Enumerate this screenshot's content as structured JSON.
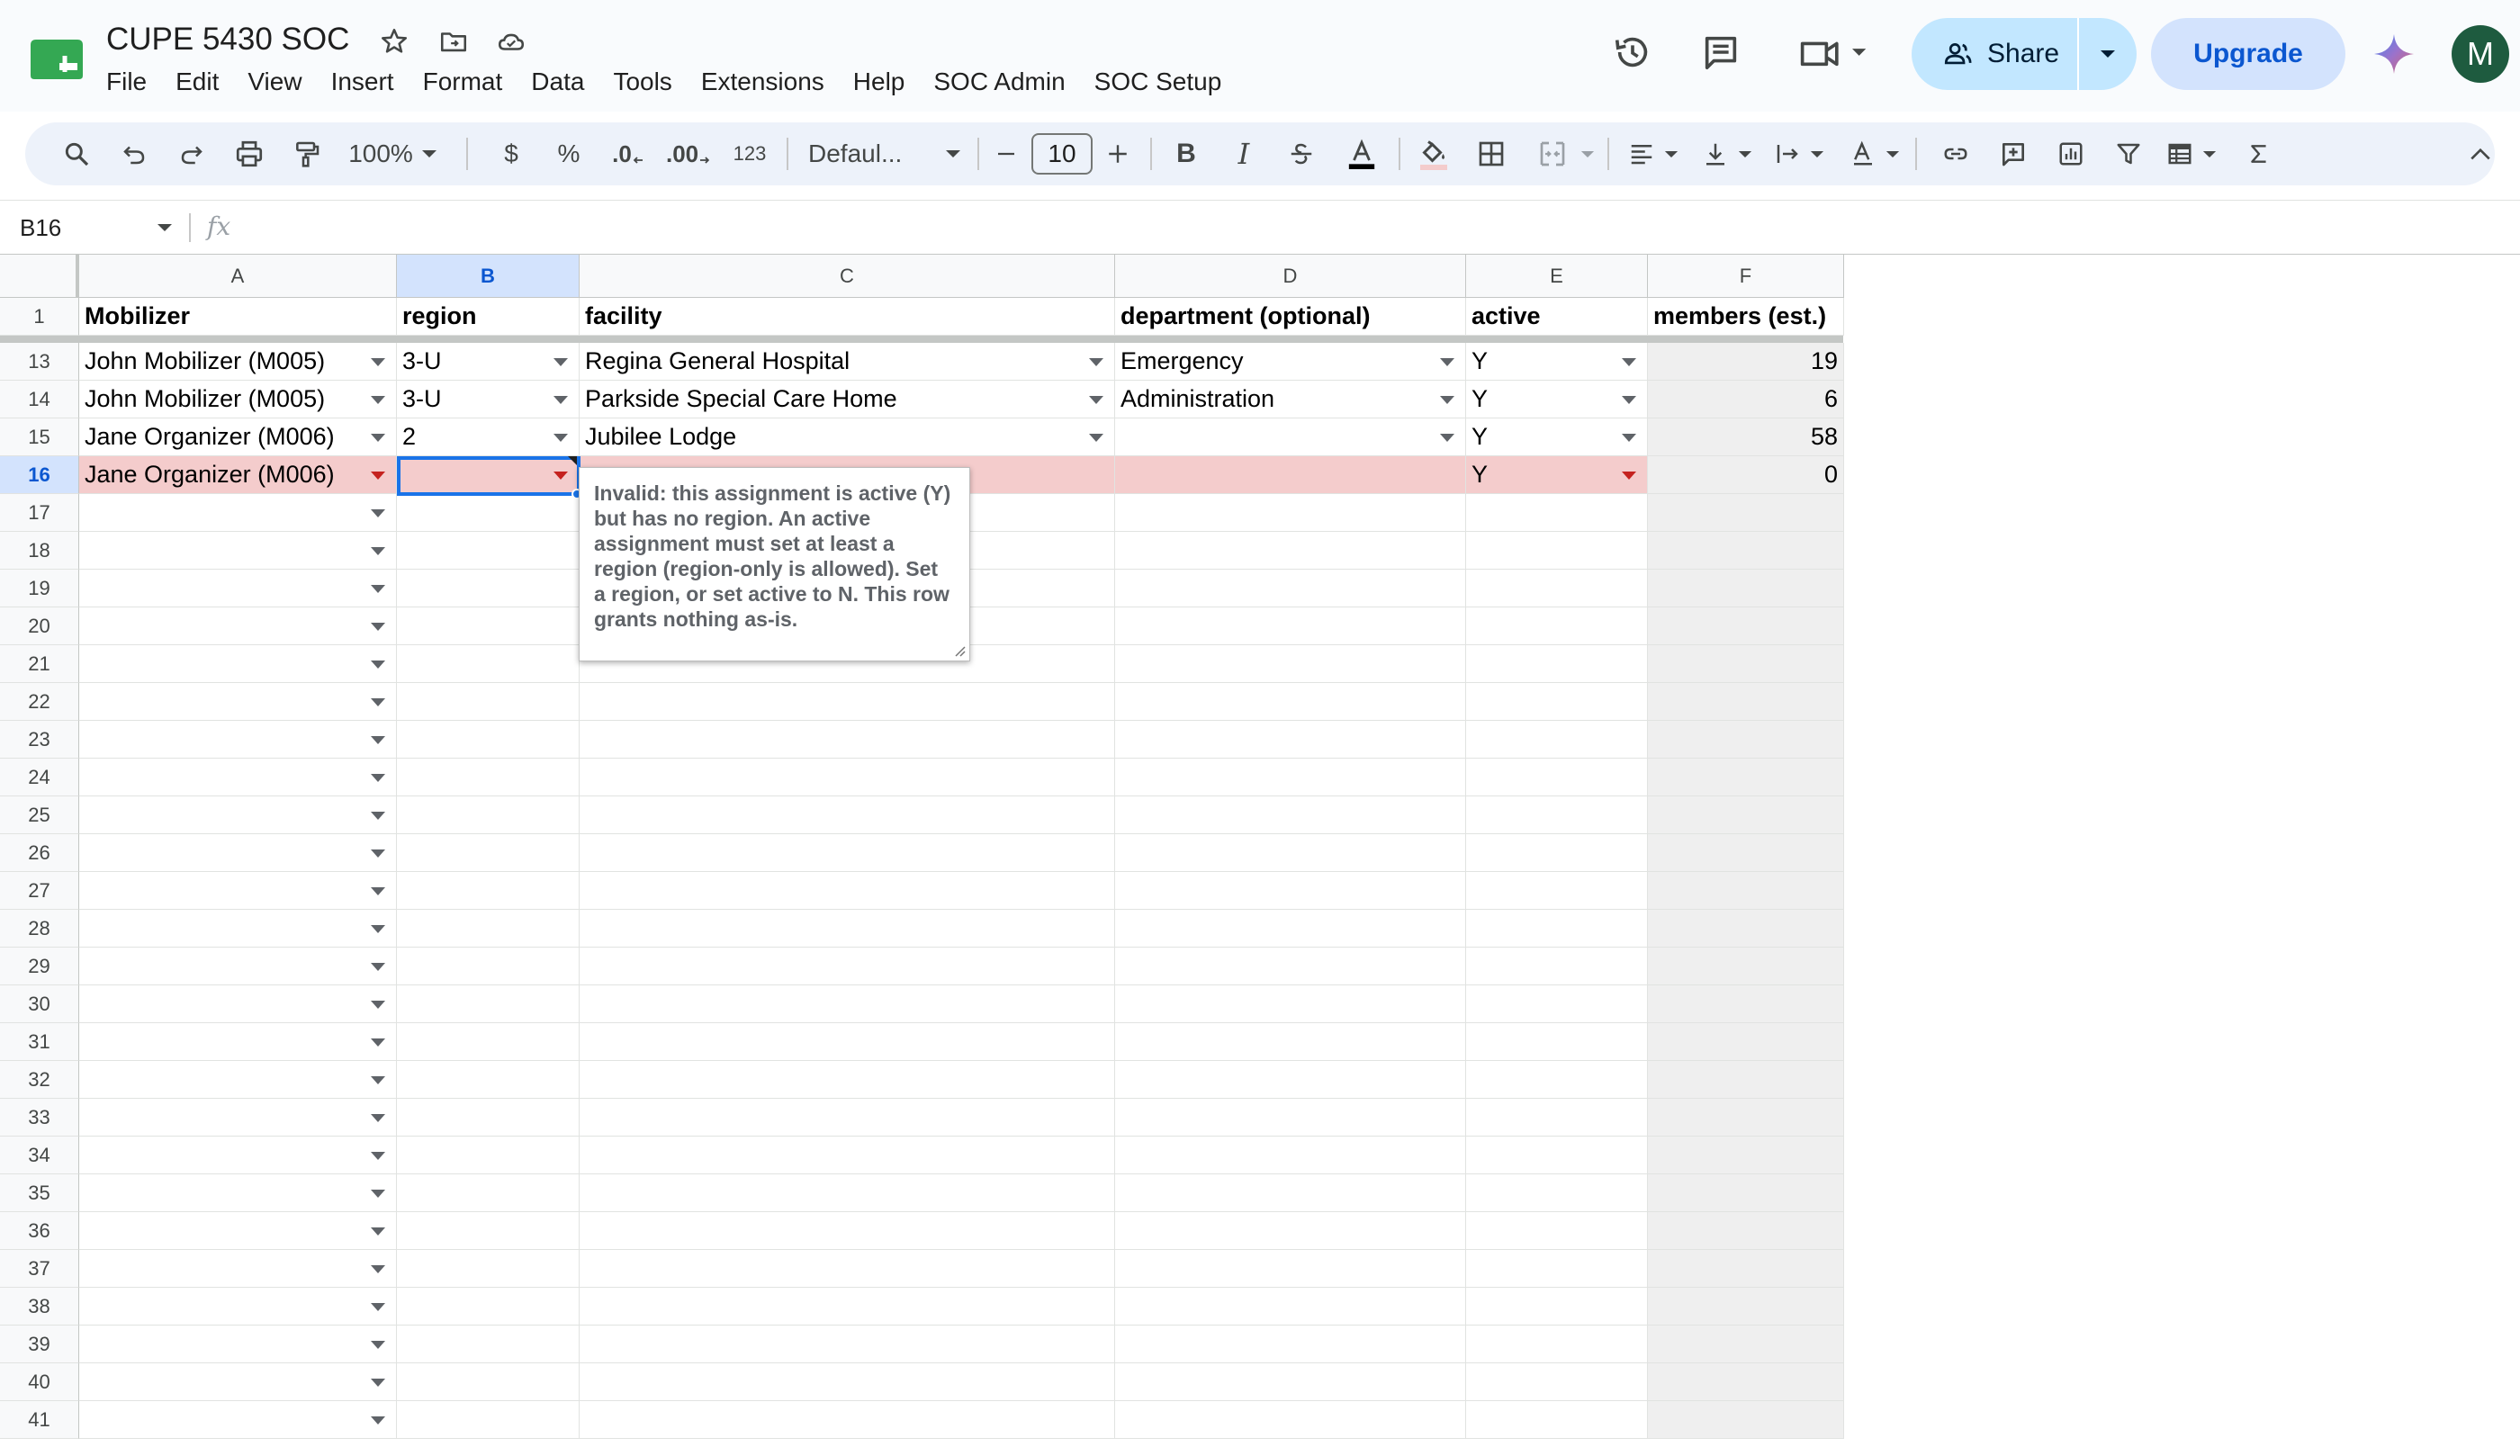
{
  "doc": {
    "title": "CUPE 5430 SOC"
  },
  "menu": [
    "File",
    "Edit",
    "View",
    "Insert",
    "Format",
    "Data",
    "Tools",
    "Extensions",
    "Help",
    "SOC Admin",
    "SOC Setup"
  ],
  "header": {
    "share_label": "Share",
    "upgrade_label": "Upgrade",
    "avatar_initial": "M"
  },
  "toolbar": {
    "zoom": "100%",
    "currency": "$",
    "percent": "%",
    "decrease_decimals": ".0",
    "increase_decimals": ".00",
    "format_123": "123",
    "font_name": "Defaul...",
    "font_size": "10",
    "bold": "B",
    "italic": "I"
  },
  "formula_bar": {
    "cell_ref": "B16",
    "fx": "fx",
    "content": ""
  },
  "columns": [
    "A",
    "B",
    "C",
    "D",
    "E",
    "F"
  ],
  "selected_column": "B",
  "header_row": {
    "row_number": "1",
    "cells": [
      "Mobilizer",
      "region",
      "facility",
      "department (optional)",
      "active",
      "members (est.)"
    ]
  },
  "data_rows": [
    {
      "row_number": "13",
      "cells": [
        "John Mobilizer (M005)",
        "3-U",
        "Regina General Hospital",
        "Emergency",
        "Y",
        "19"
      ]
    },
    {
      "row_number": "14",
      "cells": [
        "John Mobilizer (M005)",
        "3-U",
        "Parkside Special Care Home",
        "Administration",
        "Y",
        "6"
      ]
    },
    {
      "row_number": "15",
      "cells": [
        "Jane Organizer (M006)",
        "2",
        "Jubilee Lodge",
        "",
        "Y",
        "58"
      ]
    },
    {
      "row_number": "16",
      "cells": [
        "Jane Organizer (M006)",
        "",
        "",
        "",
        "Y",
        "0"
      ]
    }
  ],
  "empty_rows": [
    "17",
    "18",
    "19",
    "20",
    "21",
    "22",
    "23",
    "24",
    "25",
    "26",
    "27",
    "28",
    "29",
    "30",
    "31",
    "32",
    "33",
    "34",
    "35",
    "36",
    "37",
    "38",
    "39",
    "40",
    "41"
  ],
  "selected_row": "16",
  "note": {
    "text": "Invalid: this assignment is active (Y) but has no region. An active assignment must set at least a region (region-only is allowed). Set a region, or set active to N. This row grants nothing as-is."
  },
  "colors": {
    "error_fill": "#f4cccc",
    "selection": "#1a73e8",
    "computed_fill": "#efefef"
  }
}
